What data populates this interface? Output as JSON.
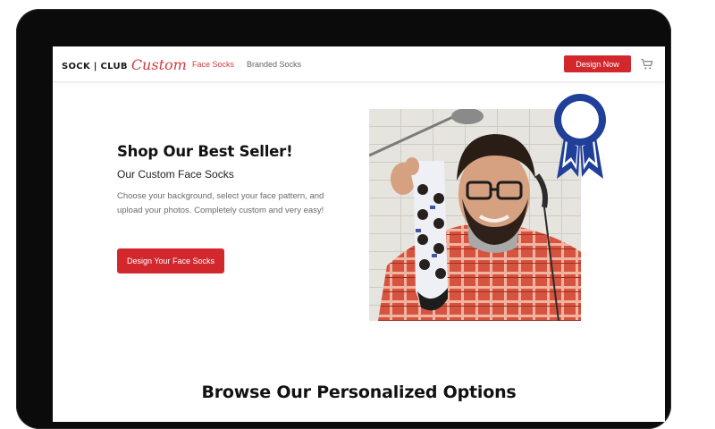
{
  "header": {
    "brand_main": "SOCK | CLUB",
    "brand_script": "Custom",
    "nav": [
      {
        "label": "Face Socks",
        "active": true
      },
      {
        "label": "Branded Socks",
        "active": false
      }
    ],
    "cta_label": "Design Now",
    "cart_icon": "cart-icon"
  },
  "hero": {
    "title": "Shop Our Best Seller!",
    "subtitle": "Our Custom Face Socks",
    "body": "Choose your background, select your face pattern, and upload your photos. Completely custom and very easy!",
    "button_label": "Design Your Face Socks",
    "badge_icon": "award-ribbon-icon"
  },
  "section": {
    "heading": "Browse Our Personalized Options"
  },
  "colors": {
    "accent": "#d2282d",
    "badge": "#1f3f99",
    "device_frame": "#0b0b0b"
  }
}
